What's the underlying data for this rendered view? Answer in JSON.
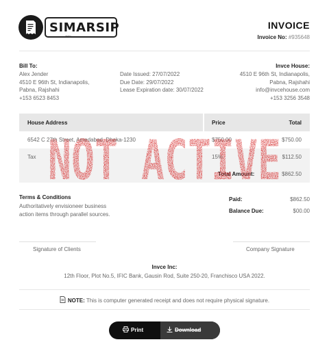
{
  "brand": {
    "name_prefix": "SIM",
    "name_suffix": "ARSIP",
    "tagline": "arsip"
  },
  "header": {
    "title": "INVOICE",
    "invoice_no_label": "Invoice No:",
    "invoice_no_value": "#935648"
  },
  "bill_to": {
    "label": "Bill To:",
    "name": "Alex Jender",
    "address1": "4510 E 96th St, Indianapolis,",
    "address2": "Pabna, Rajshahi",
    "phone": "+153 6523 8453"
  },
  "dates": {
    "issued": "Date Issued: 27/07/2022",
    "due": "Due Date: 29/07/2022",
    "lease": "Lease Expiration date: 30/07/2022"
  },
  "house": {
    "label": "Invce House:",
    "address1": "4510 E 96th St, Indianapolis,",
    "address2": "Pabna, Rajshahi",
    "email": "info@invcehouse.com",
    "phone": "+153 3256 3548"
  },
  "table": {
    "headers": [
      "House Address",
      "Price",
      "Total"
    ],
    "rows": [
      {
        "c1": "6542 C 27th Street, Amedabad, Dhaka-1230",
        "c2": "$750.00",
        "c3": "$750.00"
      },
      {
        "c1": "Tax",
        "c2": "15%",
        "c3": "$112.50"
      }
    ],
    "total_label": "Total Amount:",
    "total_value": "$862.50"
  },
  "terms": {
    "title": "Terms & Conditions",
    "line1": "Authoritatively envisioneer business",
    "line2": "action items through parallel sources."
  },
  "payment": {
    "paid_label": "Paid:",
    "paid_value": "$862.50",
    "balance_label": "Balance Due:",
    "balance_value": "$00.00"
  },
  "signatures": {
    "client": "Signature of Clients",
    "company": "Company Signature"
  },
  "company_footer": {
    "name": "Invce Inc:",
    "address": "12th Floor, Plot No.5, IFIC Bank, Gausin Rod, Suite 250-20, Franchisco USA 2022."
  },
  "note": {
    "label": "NOTE:",
    "text": "This is computer generated receipt and does not require physical signature."
  },
  "buttons": {
    "print": "Print",
    "download": "Download"
  },
  "stamp": {
    "text": "NOT ACTIVE",
    "color": "#d42020"
  },
  "icons": [
    "receipt-logo-icon",
    "document-icon",
    "printer-icon",
    "download-icon"
  ]
}
